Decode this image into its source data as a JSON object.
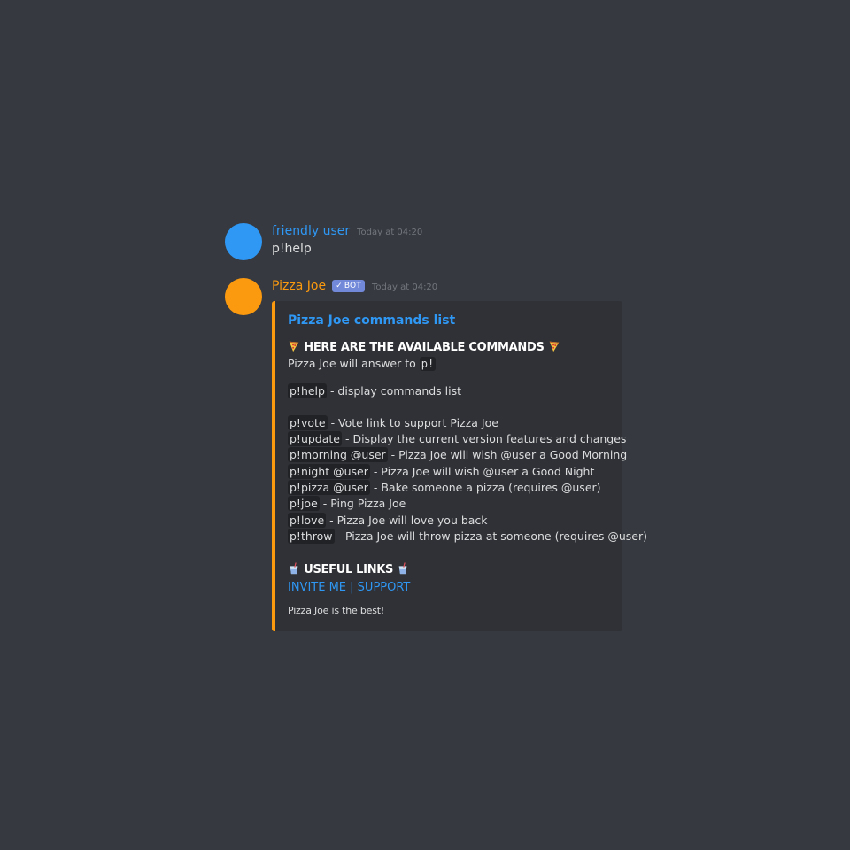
{
  "messages": [
    {
      "username": "friendly user",
      "timestamp": "Today at 04:20",
      "text": "p!help",
      "avatar_color": "#2f97f4"
    },
    {
      "username": "Pizza Joe",
      "bot_tag": "BOT",
      "timestamp": "Today at 04:20",
      "avatar_color": "#fb9a0f",
      "embed": {
        "title": "Pizza Joe commands list",
        "heading": "HERE ARE THE AVAILABLE COMMANDS",
        "prefix_text": "Pizza Joe will answer to",
        "prefix": "p!",
        "help_cmd": "p!help",
        "help_desc": " - display commands list",
        "commands": [
          {
            "cmd": "p!vote",
            "desc": " - Vote link to support Pizza Joe"
          },
          {
            "cmd": "p!update",
            "desc": " - Display the current version features and changes"
          },
          {
            "cmd": "p!morning @user",
            "desc": " - Pizza Joe will wish @user a Good Morning"
          },
          {
            "cmd": "p!night @user",
            "desc": " - Pizza Joe will wish @user a Good Night"
          },
          {
            "cmd": "p!pizza @user",
            "desc": " - Bake someone a pizza (requires @user)"
          },
          {
            "cmd": "p!joe",
            "desc": " - Ping Pizza Joe"
          },
          {
            "cmd": "p!love",
            "desc": " - Pizza Joe will love you back"
          },
          {
            "cmd": "p!throw",
            "desc": " - Pizza Joe will throw pizza at someone (requires @user)"
          }
        ],
        "links_heading": "USEFUL LINKS",
        "invite_label": "INVITE ME",
        "link_separator": " | ",
        "support_label": "SUPPORT",
        "footer": "Pizza Joe is the best!",
        "accent_color": "#fb9a0f"
      }
    }
  ]
}
